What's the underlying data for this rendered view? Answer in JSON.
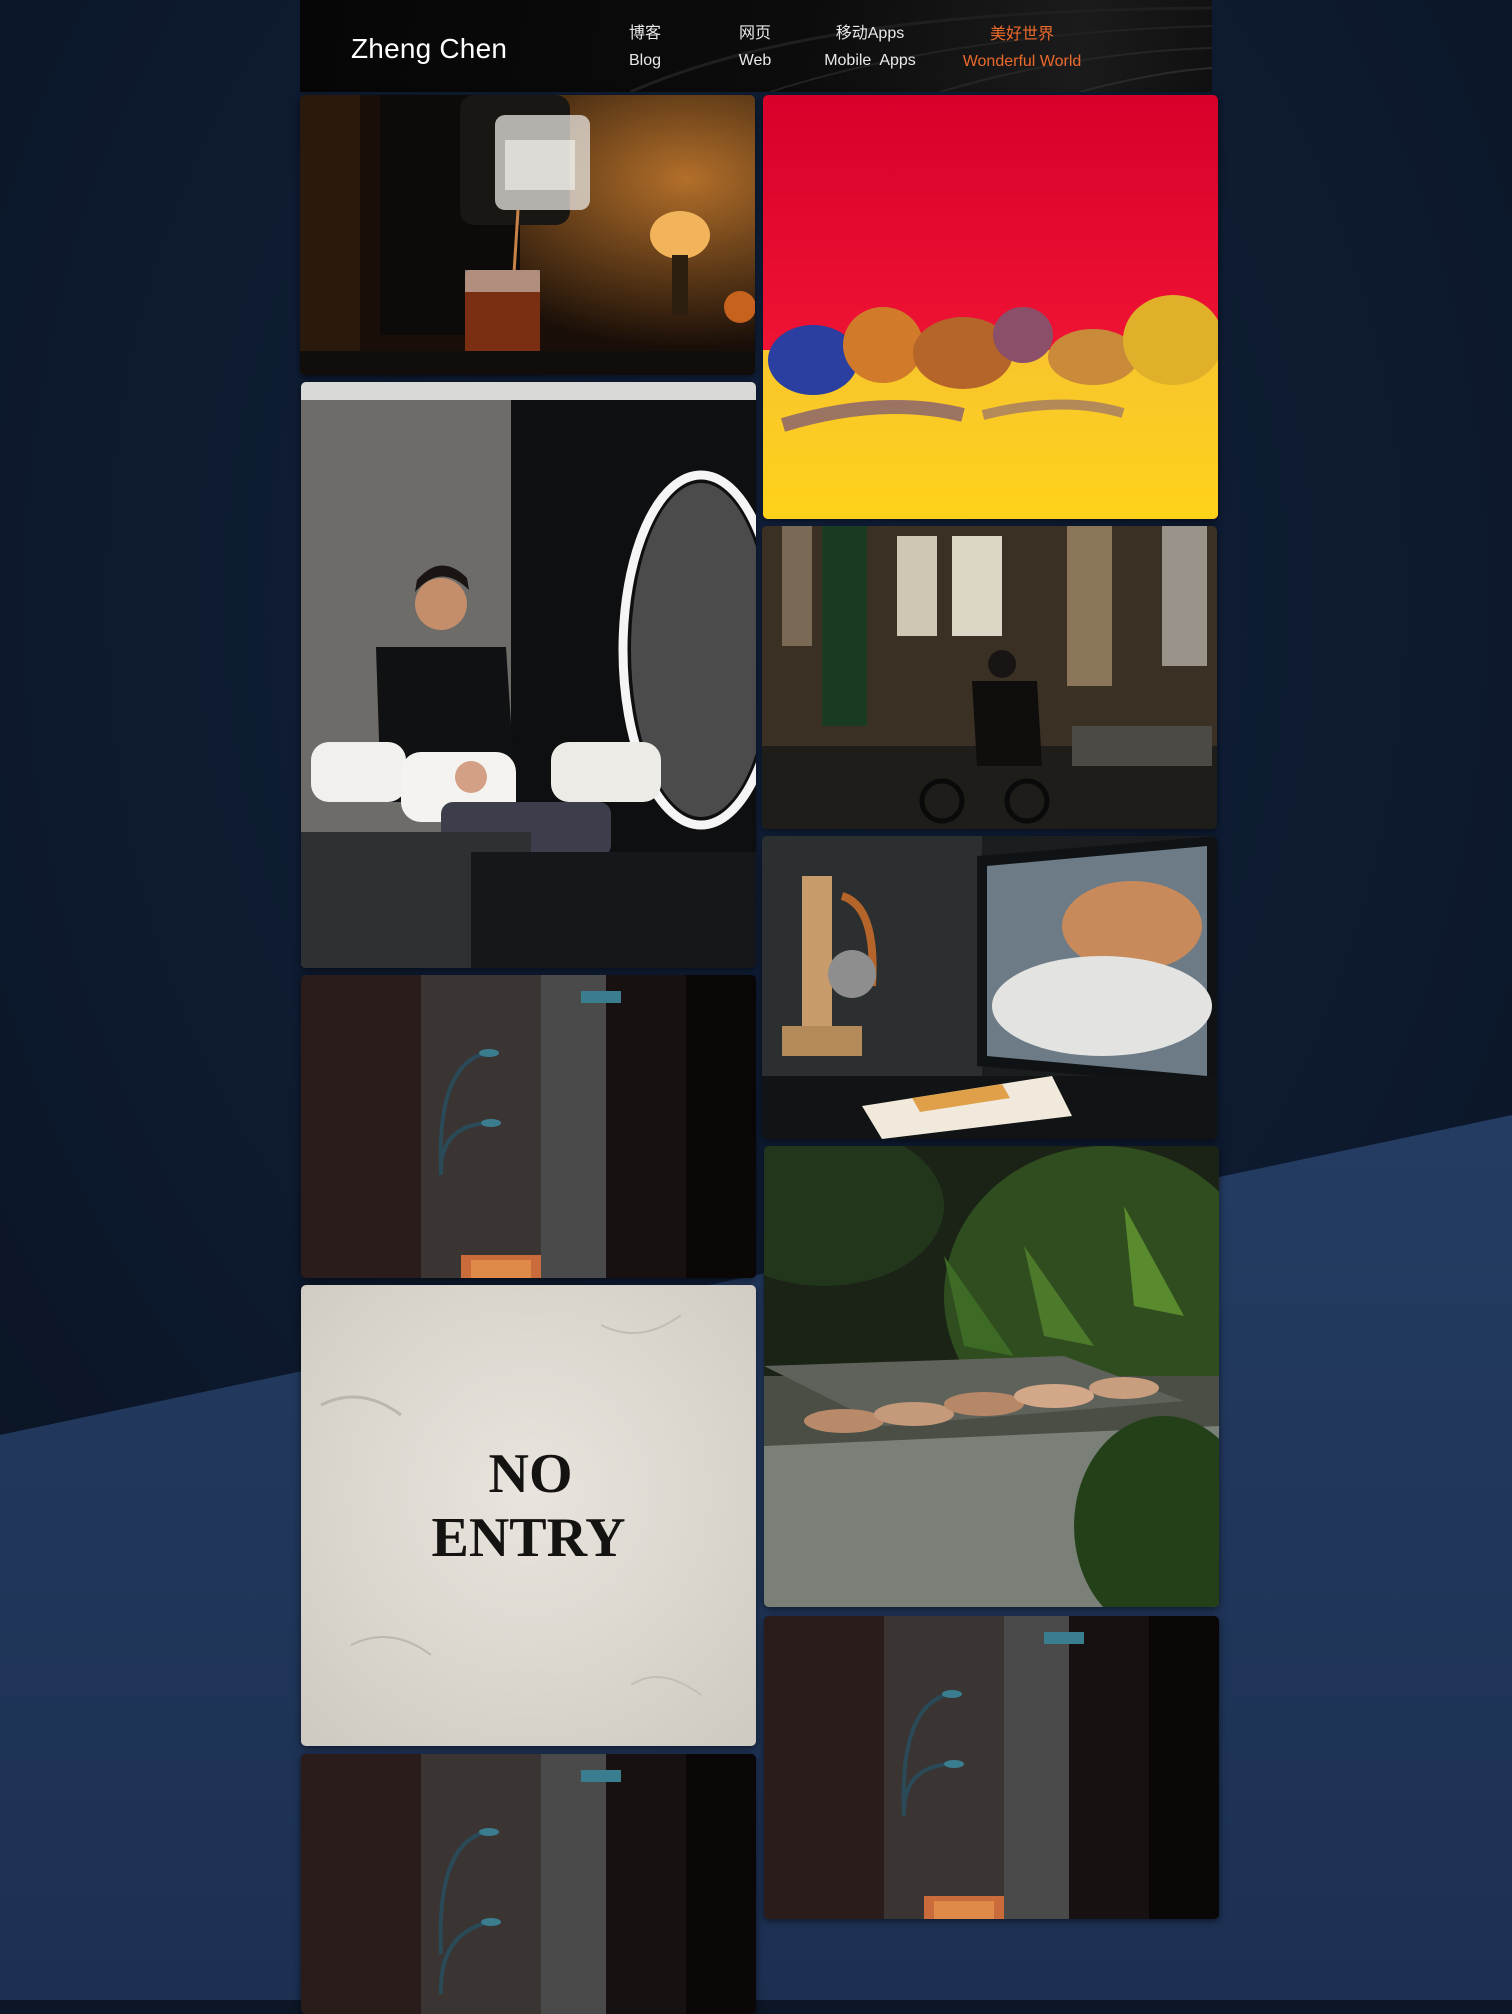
{
  "header": {
    "logo": "Zheng Chen",
    "nav": [
      {
        "zh": "博客",
        "en": "Blog",
        "active": false
      },
      {
        "zh": "网页",
        "en": "Web",
        "active": false
      },
      {
        "zh": "移动Apps",
        "en": "Mobile  Apps",
        "active": false
      },
      {
        "zh": "美好世界",
        "en": "Wonderful World",
        "active": true
      }
    ]
  },
  "colors": {
    "accent": "#ec6a2b",
    "header_bg": "#0a0a0a",
    "page_bg_dark": "#0c1626",
    "page_bg_blue": "#1f3354"
  },
  "gallery": {
    "left_column": [
      {
        "name": "cocktail-pour-photo"
      },
      {
        "name": "barber-salon-photo"
      },
      {
        "name": "alley-lamps-photo"
      },
      {
        "name": "no-entry-wall-photo",
        "text_line1": "NO",
        "text_line2": "ENTRY"
      },
      {
        "name": "alley-lamps-photo-2"
      }
    ],
    "right_column": [
      {
        "name": "infrared-landscape-photo"
      },
      {
        "name": "cyclist-street-photo"
      },
      {
        "name": "desk-setup-photo"
      },
      {
        "name": "garden-lounge-photo"
      },
      {
        "name": "alley-lamps-photo-3"
      }
    ]
  }
}
